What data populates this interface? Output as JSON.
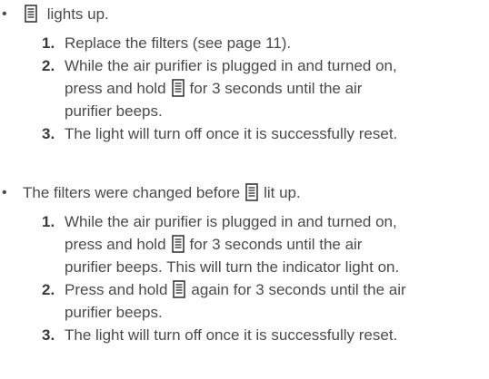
{
  "sections": [
    {
      "bullet_text": "lights up.",
      "steps": [
        {
          "num": "1.",
          "text": "Replace the filters (see page 11)."
        },
        {
          "num": "2.",
          "pre": "While the air purifier is plugged in and turned on,",
          "line2_pre": "press and hold",
          "post": "for 3 seconds until the air",
          "line3": "purifier beeps."
        },
        {
          "num": "3.",
          "text": "The light will turn off once it is successfully reset."
        }
      ]
    },
    {
      "bullet_pre": "The filters were changed before",
      "bullet_post": "lit up.",
      "steps": [
        {
          "num": "1.",
          "pre": "While the air purifier is plugged in and turned on,",
          "line2_pre": "press and hold",
          "post": "for 3 seconds until the air",
          "line3": "purifier beeps. This will turn the indicator light on."
        },
        {
          "num": "2.",
          "pre": "Press and hold",
          "post": "again for 3 seconds until the air",
          "line2": "purifier beeps."
        },
        {
          "num": "3.",
          "text": "The light will turn off once it is successfully reset."
        }
      ]
    }
  ],
  "icon": "filter-indicator-icon"
}
